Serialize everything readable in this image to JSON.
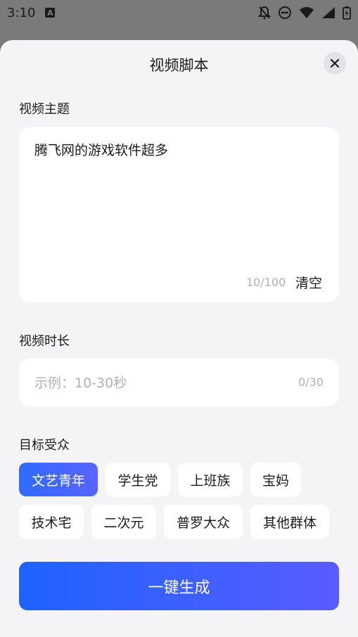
{
  "status_bar": {
    "time": "3:10",
    "notif_badge": "A",
    "icons": [
      "bell-off-icon",
      "do-not-disturb-icon",
      "wifi-icon",
      "signal-icon",
      "battery-icon"
    ]
  },
  "sheet": {
    "title": "视频脚本",
    "close_icon": "close-icon"
  },
  "topic": {
    "label": "视频主题",
    "value": "腾飞网的游戏软件超多",
    "count": "10/100",
    "clear_label": "清空"
  },
  "duration": {
    "label": "视频时长",
    "placeholder": "示例：10-30秒",
    "count": "0/30"
  },
  "audience": {
    "label": "目标受众",
    "chips": [
      "文艺青年",
      "学生党",
      "上班族",
      "宝妈",
      "技术宅",
      "二次元",
      "普罗大众",
      "其他群体"
    ],
    "selected": "文艺青年"
  },
  "generate_label": "一键生成",
  "colors": {
    "accent_start": "#1e63ff",
    "accent_end": "#5a5cff",
    "sheet_bg": "#f4f4f6",
    "scrim": "#7a7a7a"
  }
}
